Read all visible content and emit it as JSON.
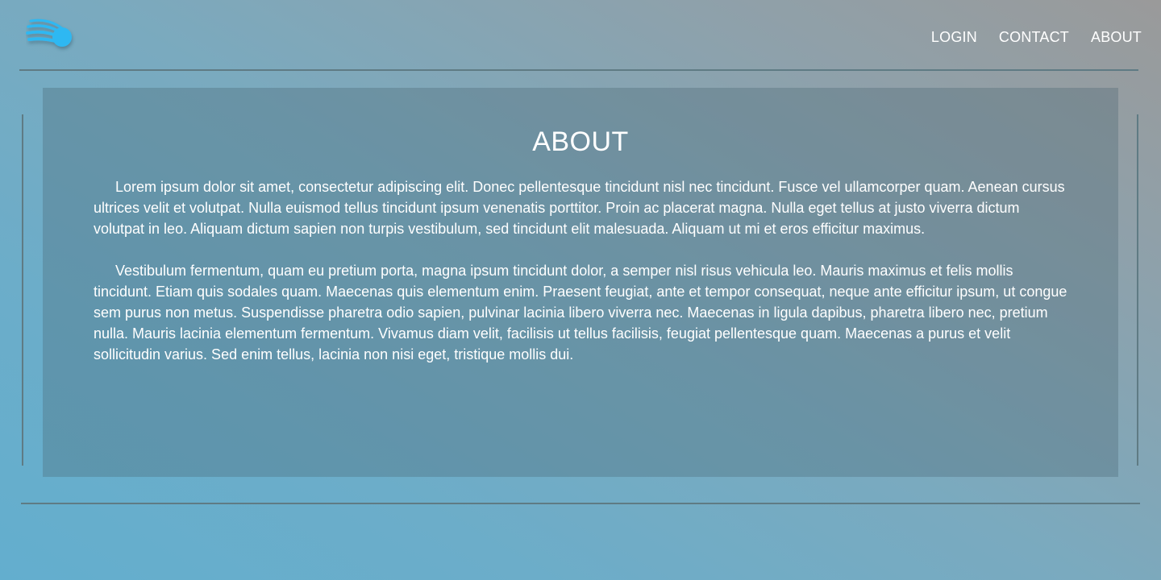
{
  "header": {
    "logo_icon": "speed-swoosh-logo-icon",
    "logo_color": "#2fb8f2",
    "nav": [
      {
        "label": "LOGIN"
      },
      {
        "label": "CONTACT"
      },
      {
        "label": "ABOUT"
      }
    ]
  },
  "main": {
    "title": "ABOUT",
    "paragraphs": [
      "Lorem ipsum dolor sit amet, consectetur adipiscing elit. Donec pellentesque tincidunt nisl nec tincidunt. Fusce vel ullamcorper quam. Aenean cursus ultrices velit et volutpat. Nulla euismod tellus tincidunt ipsum venenatis porttitor. Proin ac placerat magna. Nulla eget tellus at justo viverra dictum volutpat in leo. Aliquam dictum sapien non turpis vestibulum, sed tincidunt elit malesuada. Aliquam ut mi et eros efficitur maximus.",
      "Vestibulum fermentum, quam eu pretium porta, magna ipsum tincidunt dolor, a semper nisl risus vehicula leo. Mauris maximus et felis mollis tincidunt. Etiam quis sodales quam. Maecenas quis elementum enim. Praesent feugiat, ante et tempor consequat, neque ante efficitur ipsum, ut congue sem purus non metus. Suspendisse pharetra odio sapien, pulvinar lacinia libero viverra nec. Maecenas in ligula dapibus, pharetra libero nec, pretium nulla. Mauris lacinia elementum fermentum. Vivamus diam velit, facilisis ut tellus facilisis, feugiat pellentesque quam. Maecenas a purus et velit sollicitudin varius. Sed enim tellus, lacinia non nisi eget, tristique mollis dui."
    ]
  }
}
